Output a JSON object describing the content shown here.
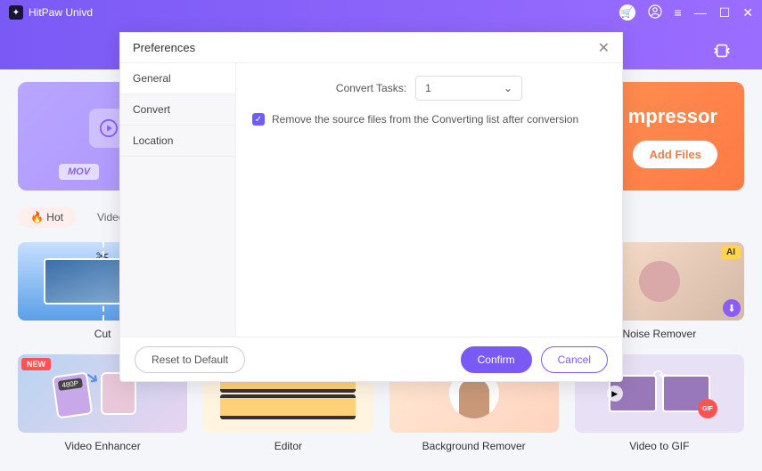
{
  "app": {
    "title": "HitPaw Univd"
  },
  "titlebar_icons": {
    "cart": "🛒",
    "user": "◯",
    "menu": "≡",
    "min": "—",
    "max": "☐",
    "close": "✕"
  },
  "main": {
    "converter_badge": "MOV",
    "compressor_title": "mpressor",
    "add_files": "Add Files"
  },
  "tags": {
    "hot": "Hot",
    "video": "Video"
  },
  "tiles": {
    "cut": "Cut",
    "noise": "Noise Remover",
    "enhancer": "Video Enhancer",
    "editor": "Editor",
    "bgremover": "Background Remover",
    "gif": "Video to GIF",
    "ai_badge": "AI",
    "new_badge": "NEW",
    "res_badge": "480P",
    "gif_badge": "GIF"
  },
  "prefs": {
    "title": "Preferences",
    "side": {
      "general": "General",
      "convert": "Convert",
      "location": "Location"
    },
    "convert_tasks_label": "Convert Tasks:",
    "convert_tasks_value": "1",
    "remove_source": "Remove the source files from the Converting list after conversion",
    "reset": "Reset to Default",
    "confirm": "Confirm",
    "cancel": "Cancel"
  }
}
